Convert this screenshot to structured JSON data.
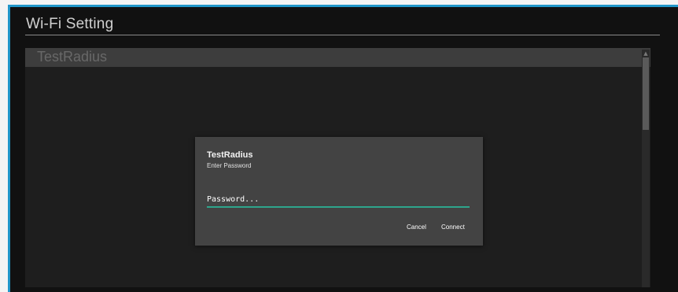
{
  "screen": {
    "title": "Wi-Fi Setting"
  },
  "network_list": {
    "selected_network": "TestRadius"
  },
  "dialog": {
    "title": "TestRadius",
    "subtitle": "Enter Password",
    "password_placeholder": "Password...",
    "cancel_label": "Cancel",
    "connect_label": "Connect"
  },
  "colors": {
    "accent_border": "#2196c9",
    "input_underline": "#2ea58c",
    "dialog_bg": "#434343"
  },
  "icons": {
    "scroll_up": "triangle-up"
  }
}
